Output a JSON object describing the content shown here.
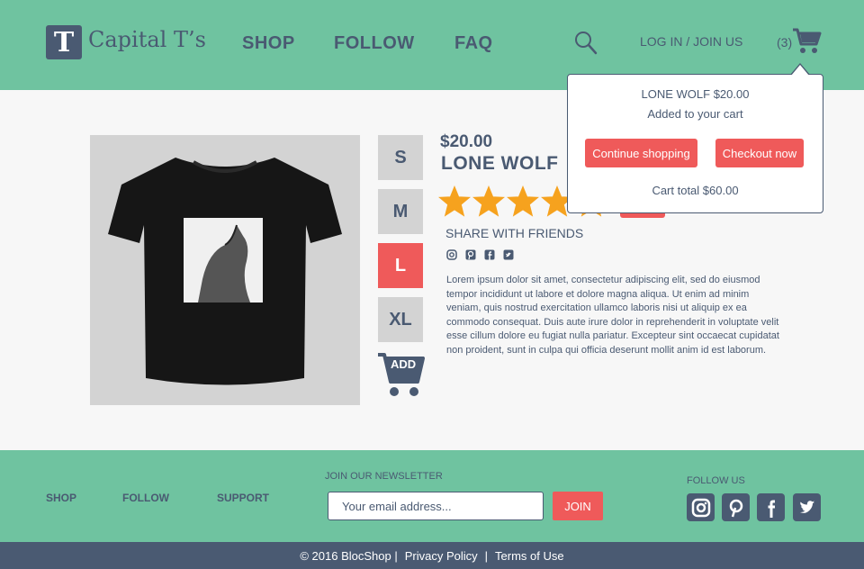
{
  "header": {
    "logo_letter": "T",
    "logo_text": "Capital T’s",
    "nav": [
      "SHOP",
      "FOLLOW",
      "FAQ"
    ],
    "login": "LOG IN / JOIN US",
    "cart_count": "(3)"
  },
  "product": {
    "price": "$20.00",
    "name": "LONE WOLF",
    "sizes": [
      "S",
      "M",
      "L",
      "XL"
    ],
    "selected_size": "L",
    "add_label": "ADD",
    "rating": 4,
    "rating_max": 5,
    "share_label": "SHARE WITH FRIENDS",
    "share_icons": [
      "instagram-icon",
      "pinterest-icon",
      "facebook-icon",
      "twitter-icon"
    ],
    "description": "Lorem ipsum dolor sit amet, consectetur adipiscing elit, sed do eiusmod tempor incididunt ut labore et dolore magna aliqua. Ut enim ad minim veniam, quis nostrud exercitation ullamco laboris nisi ut aliquip ex ea commodo consequat. Duis aute irure dolor in reprehenderit in voluptate velit esse cillum dolore eu fugiat nulla pariatur. Excepteur sint occaecat cupidatat non proident, sunt in culpa qui officia deserunt mollit anim id est laborum."
  },
  "popup": {
    "title": "LONE WOLF $20.00",
    "subtitle": "Added to your cart",
    "continue_label": "Continue shopping",
    "checkout_label": "Checkout now",
    "total": "Cart total  $60.00"
  },
  "footer": {
    "links": [
      "SHOP",
      "FOLLOW",
      "SUPPORT"
    ],
    "newsletter_label": "JOIN OUR NEWSLETTER",
    "email_placeholder": "Your email address...",
    "join_label": "JOIN",
    "follow_label": "FOLLOW US",
    "copyright": "© 2016 BlocShop |",
    "privacy": "Privacy Policy",
    "separator": "|",
    "terms": "Terms of Use"
  },
  "colors": {
    "green": "#6fc3a0",
    "navy": "#4a5a72",
    "red": "#ef5a5a",
    "star": "#f6a21e"
  }
}
